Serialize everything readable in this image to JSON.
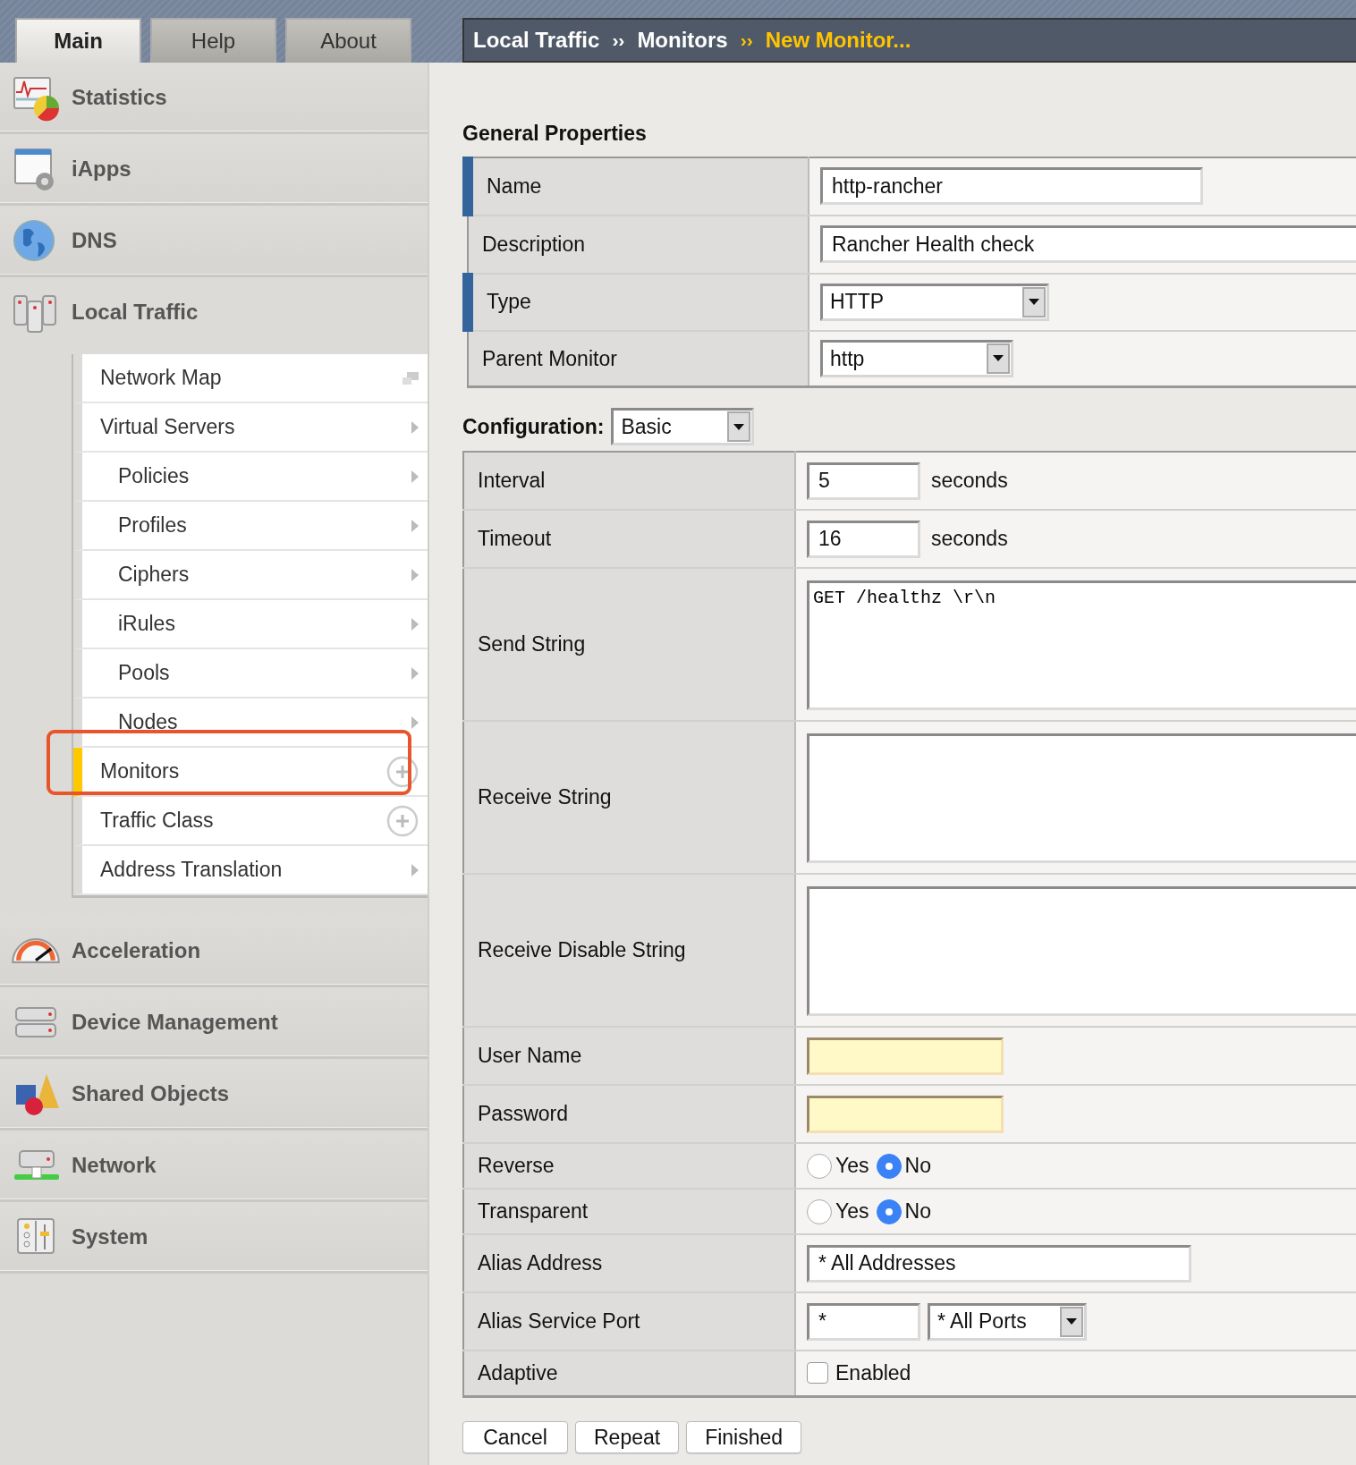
{
  "tabs": [
    {
      "label": "Main",
      "selected": true
    },
    {
      "label": "Help",
      "selected": false
    },
    {
      "label": "About",
      "selected": false
    }
  ],
  "breadcrumb": [
    {
      "kind": "link",
      "label": "Local Traffic",
      "current": false
    },
    {
      "kind": "separator",
      "label": "››",
      "current": false
    },
    {
      "kind": "link",
      "label": "Monitors",
      "current": false
    },
    {
      "kind": "separator",
      "label": "››",
      "current": true
    },
    {
      "kind": "link",
      "label": "New Monitor...",
      "current": true
    }
  ],
  "sidebar": {
    "sections": [
      {
        "label": "Statistics"
      },
      {
        "label": "iApps"
      },
      {
        "label": "DNS"
      },
      {
        "label": "Local Traffic",
        "expanded": true,
        "children": [
          {
            "label": "Network Map",
            "kind": "popup",
            "selected": false,
            "highlighted": false
          },
          {
            "label": "Virtual Servers",
            "kind": "arrow",
            "selected": false,
            "highlighted": false,
            "children": [
              {
                "label": "Policies",
                "kind": "arrow",
                "selected": false,
                "highlighted": false
              },
              {
                "label": "Profiles",
                "kind": "arrow",
                "selected": false,
                "highlighted": false
              },
              {
                "label": "Ciphers",
                "kind": "arrow",
                "selected": false,
                "highlighted": false
              },
              {
                "label": "iRules",
                "kind": "arrow",
                "selected": false,
                "highlighted": false
              },
              {
                "label": "Pools",
                "kind": "arrow",
                "selected": false,
                "highlighted": false
              },
              {
                "label": "Nodes",
                "kind": "arrow",
                "selected": false,
                "highlighted": false
              }
            ]
          },
          {
            "label": "Monitors",
            "kind": "create",
            "selected": true,
            "highlighted": true
          },
          {
            "label": "Traffic Class",
            "kind": "create",
            "selected": false,
            "highlighted": false
          },
          {
            "label": "Address Translation",
            "kind": "arrow",
            "selected": false,
            "highlighted": false
          }
        ]
      },
      {
        "label": "Acceleration"
      },
      {
        "label": "Device Management"
      },
      {
        "label": "Shared Objects"
      },
      {
        "label": "Network"
      },
      {
        "label": "System"
      }
    ]
  },
  "general": {
    "title": "General Properties",
    "rows": [
      {
        "label": "Name",
        "required": true,
        "kind": "text",
        "value": "http-rancher"
      },
      {
        "label": "Description",
        "required": false,
        "kind": "wide-text",
        "value": "Rancher Health check"
      },
      {
        "label": "Type",
        "required": true,
        "kind": "select",
        "value": "HTTP"
      },
      {
        "label": "Parent Monitor",
        "required": false,
        "kind": "select",
        "value": "http"
      }
    ]
  },
  "configuration": {
    "label": "Configuration:",
    "value": "Basic",
    "rows": [
      {
        "label": "Interval",
        "kind": "number",
        "value": "5",
        "unit": "seconds"
      },
      {
        "label": "Timeout",
        "kind": "number",
        "value": "16",
        "unit": "seconds"
      },
      {
        "label": "Send String",
        "kind": "textarea",
        "value": "GET /healthz \\r\\n"
      },
      {
        "label": "Receive String",
        "kind": "textarea"
      },
      {
        "label": "Receive Disable String",
        "kind": "textarea"
      },
      {
        "label": "User Name",
        "kind": "credential"
      },
      {
        "label": "Password",
        "kind": "credential"
      },
      {
        "label": "Reverse",
        "kind": "radio",
        "options": [
          {
            "label": "Yes",
            "selected": false
          },
          {
            "label": "No",
            "selected": true
          }
        ]
      },
      {
        "label": "Transparent",
        "kind": "radio",
        "options": [
          {
            "label": "Yes",
            "selected": false
          },
          {
            "label": "No",
            "selected": true
          }
        ]
      },
      {
        "label": "Alias Address",
        "kind": "text",
        "value": "* All Addresses"
      },
      {
        "label": "Alias Service Port",
        "kind": "port",
        "value": "*",
        "select": "* All Ports"
      },
      {
        "label": "Adaptive",
        "kind": "checkbox",
        "text": "Enabled",
        "checked": false
      }
    ]
  },
  "buttons": [
    "Cancel",
    "Repeat",
    "Finished"
  ]
}
